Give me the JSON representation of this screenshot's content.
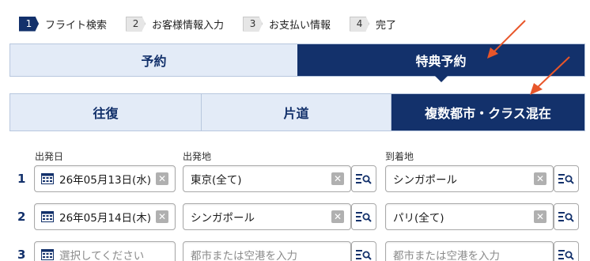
{
  "steps": [
    {
      "num": "1",
      "label": "フライト検索"
    },
    {
      "num": "2",
      "label": "お客様情報入力"
    },
    {
      "num": "3",
      "label": "お支払い情報"
    },
    {
      "num": "4",
      "label": "完了"
    }
  ],
  "booking_tabs": [
    {
      "label": "予約"
    },
    {
      "label": "特典予約"
    }
  ],
  "trip_tabs": [
    {
      "label": "往復"
    },
    {
      "label": "片道"
    },
    {
      "label": "複数都市・クラス混在"
    }
  ],
  "labels": {
    "departure_date": "出発日",
    "departure_place": "出発地",
    "arrival_place": "到着地"
  },
  "rows": [
    {
      "num": "1",
      "date": "26年05月13日(水)",
      "from": "東京(全て)",
      "to": "シンガポール"
    },
    {
      "num": "2",
      "date": "26年05月14日(木)",
      "from": "シンガポール",
      "to": "パリ(全て)"
    },
    {
      "num": "3",
      "date": "選択してください",
      "from": "都市または空港を入力",
      "to": "都市または空港を入力"
    }
  ],
  "colors": {
    "navy": "#13316b",
    "light_tab": "#e3ebf7",
    "arrow": "#e8562a"
  }
}
